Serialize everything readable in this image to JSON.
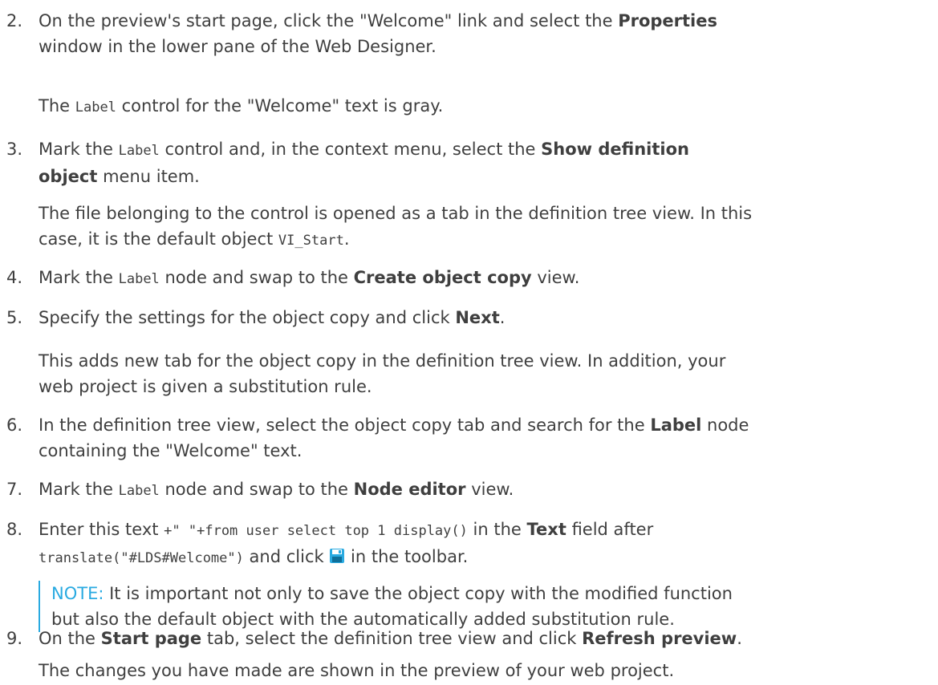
{
  "steps": [
    {
      "number": "2.",
      "line1_a": "On the preview's start page, click the \"Welcome\" link and select the ",
      "line1_b": "Properties",
      "line2": "window in the lower pane of the Web Designer.",
      "result_a": "The ",
      "result_code": "Label",
      "result_b": " control for the \"Welcome\" text is gray."
    },
    {
      "number": "3.",
      "a": "Mark the ",
      "code": "Label",
      "b": " control and, in the context menu, select the ",
      "bold1": "Show definition",
      "bold2": "object",
      "c": " menu item.",
      "result_line1": "The file belonging to the control is opened as a tab in the definition tree view. In this",
      "result_line2_a": "case, it is the default object ",
      "result_line2_code": "VI_Start",
      "result_line2_b": "."
    },
    {
      "number": "4.",
      "a": "Mark the ",
      "code": "Label",
      "b": " node and swap to the ",
      "bold": "Create object copy",
      "c": " view."
    },
    {
      "number": "5.",
      "a": "Specify the settings for the object copy and click ",
      "bold": "Next",
      "b": ".",
      "result_line1": "This adds new tab for the object copy in the definition tree view. In addition, your",
      "result_line2": "web project is given a substitution rule."
    },
    {
      "number": "6.",
      "a": "In the definition tree view, select the object copy tab and search for the ",
      "bold": "Label",
      "b": " node",
      "line2": "containing the \"Welcome\" text."
    },
    {
      "number": "7.",
      "a": "Mark the ",
      "code": "Label",
      "b": " node and swap to the ",
      "bold": "Node editor",
      "c": " view."
    },
    {
      "number": "8.",
      "a": "Enter this text ",
      "code1": " +\" \"+from user select top 1 display()",
      "b": " in the ",
      "bold": "Text",
      "c": " field after",
      "code2": "translate(\"#LDS#Welcome\")",
      "d": " and click ",
      "e": " in the toolbar.",
      "note_label": "NOTE:",
      "note_line1": " It is important not only to save the object copy with the modified function",
      "note_line2": "but also the default object with the automatically added substitution rule."
    },
    {
      "number": "9.",
      "a": "On the ",
      "bold1": "Start page",
      "b": " tab, select the definition tree view and click ",
      "bold2": "Refresh preview",
      "c": ".",
      "result": "The changes you have made are shown in the preview of your web project."
    }
  ],
  "colors": {
    "text": "#3f3f3f",
    "note_accent": "#29aae1",
    "save_icon": "#29aae1"
  },
  "icons": {
    "save": "save-icon"
  }
}
